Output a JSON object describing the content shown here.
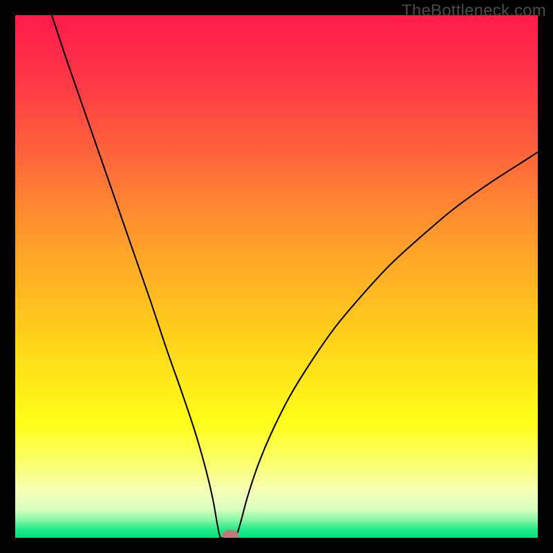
{
  "watermark": "TheBottleneck.com",
  "chart_data": {
    "type": "line",
    "title": "",
    "xlabel": "",
    "ylabel": "",
    "xlim": [
      0,
      100
    ],
    "ylim": [
      0,
      100
    ],
    "background": {
      "type": "vertical-gradient",
      "stops": [
        {
          "offset": 0.0,
          "color": "#ff1b4b"
        },
        {
          "offset": 0.12,
          "color": "#ff3647"
        },
        {
          "offset": 0.28,
          "color": "#ff6a3a"
        },
        {
          "offset": 0.45,
          "color": "#ffa329"
        },
        {
          "offset": 0.62,
          "color": "#ffd21a"
        },
        {
          "offset": 0.78,
          "color": "#ffff1a"
        },
        {
          "offset": 0.86,
          "color": "#fbff70"
        },
        {
          "offset": 0.91,
          "color": "#f5ffb8"
        },
        {
          "offset": 0.945,
          "color": "#d8ffc0"
        },
        {
          "offset": 0.965,
          "color": "#8cf7a8"
        },
        {
          "offset": 0.985,
          "color": "#1de987"
        },
        {
          "offset": 1.0,
          "color": "#05e07c"
        }
      ]
    },
    "series": [
      {
        "name": "bottleneck-curve",
        "stroke": "#000000",
        "stroke_width": 2.1,
        "points": [
          {
            "x": 7.0,
            "y": 100.0
          },
          {
            "x": 10.0,
            "y": 91.0
          },
          {
            "x": 14.0,
            "y": 79.5
          },
          {
            "x": 18.0,
            "y": 68.0
          },
          {
            "x": 22.0,
            "y": 56.5
          },
          {
            "x": 26.0,
            "y": 45.0
          },
          {
            "x": 29.0,
            "y": 36.0
          },
          {
            "x": 32.0,
            "y": 27.5
          },
          {
            "x": 34.5,
            "y": 20.0
          },
          {
            "x": 36.5,
            "y": 13.0
          },
          {
            "x": 37.8,
            "y": 7.5
          },
          {
            "x": 38.6,
            "y": 3.0
          },
          {
            "x": 39.1,
            "y": 0.5
          },
          {
            "x": 39.5,
            "y": 0.0
          },
          {
            "x": 42.0,
            "y": 0.0
          },
          {
            "x": 42.4,
            "y": 0.5
          },
          {
            "x": 43.2,
            "y": 3.2
          },
          {
            "x": 44.5,
            "y": 8.0
          },
          {
            "x": 46.5,
            "y": 14.0
          },
          {
            "x": 49.0,
            "y": 20.0
          },
          {
            "x": 52.5,
            "y": 27.0
          },
          {
            "x": 56.5,
            "y": 33.5
          },
          {
            "x": 61.0,
            "y": 40.0
          },
          {
            "x": 66.0,
            "y": 46.0
          },
          {
            "x": 71.5,
            "y": 52.0
          },
          {
            "x": 77.5,
            "y": 57.5
          },
          {
            "x": 84.0,
            "y": 63.0
          },
          {
            "x": 91.0,
            "y": 68.0
          },
          {
            "x": 98.0,
            "y": 72.5
          },
          {
            "x": 100.0,
            "y": 73.8
          }
        ]
      }
    ],
    "markers": [
      {
        "name": "optimal-point",
        "x": 41.2,
        "y": 0.5,
        "rx": 1.6,
        "ry": 1.0,
        "fill": "#c07a78"
      }
    ]
  }
}
